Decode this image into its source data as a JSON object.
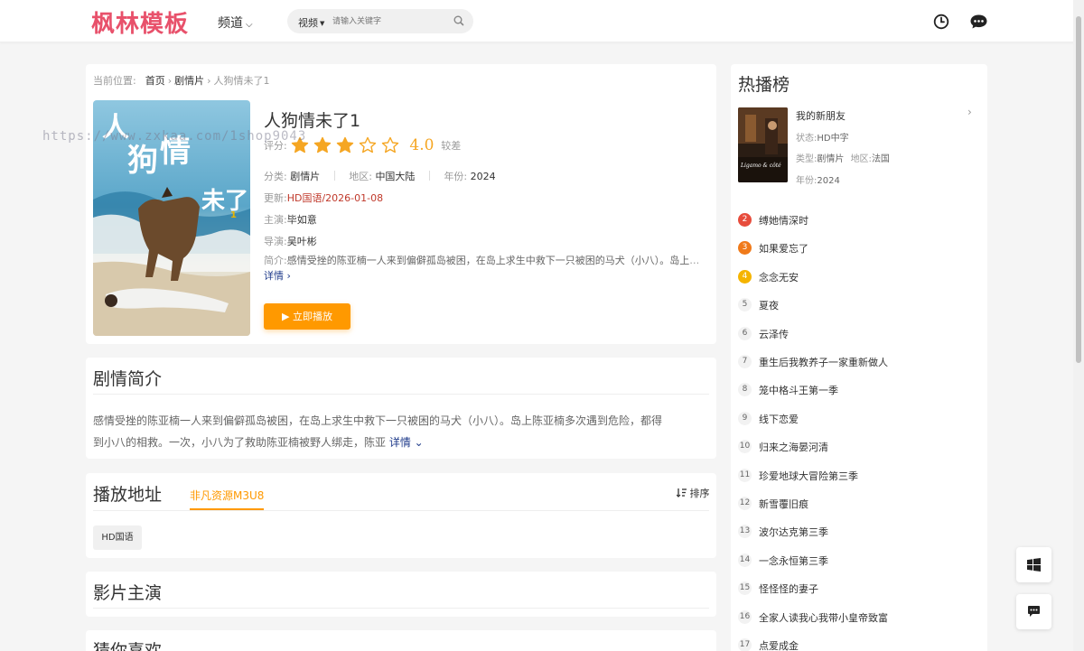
{
  "header": {
    "logo": "枫林模板",
    "channel_label": "频道",
    "search_type": "视频",
    "search_placeholder": "请输入关键字",
    "icons": [
      "history-icon",
      "chat-icon",
      "search-icon"
    ]
  },
  "breadcrumb": {
    "label": "当前位置:",
    "home": "首页",
    "category": "剧情片",
    "current": "人狗情未了1"
  },
  "movie": {
    "title": "人狗情未了1",
    "rating_label": "评分:",
    "rating_value": 3,
    "rating_max": 5,
    "score": "4.0",
    "grade": "较差",
    "genre_label": "分类:",
    "genre": "剧情片",
    "region_label": "地区:",
    "region": "中国大陆",
    "year_label": "年份:",
    "year": "2024",
    "update_label": "更新:",
    "update": "HD国语/2026-01-08",
    "actor_label": "主演:",
    "actor": "毕如意",
    "director_label": "导演:",
    "director": "吴叶彬",
    "brief_label": "简介:",
    "brief": "感情受挫的陈亚楠一人来到偏僻孤岛被困，在岛上求生中救下一只被困的马犬（小八）。岛上陈亚楠多次遇到危险，都得到小八的相救。",
    "more_label": "详情 ›",
    "play_label": "▶ 立即播放"
  },
  "watermark": "https://www.zxkaa.com/1shop9043",
  "synopsis": {
    "title": "剧情简介",
    "line1": "感情受挫的陈亚楠一人来到偏僻孤岛被困，在岛上求生中救下一只被困的马犬（小八）。岛上陈亚楠多次遇到危险，都得",
    "line2": "到小八的相救。一次，小八为了救助陈亚楠被野人绑走，陈亚",
    "more_label": "详情 ⌄"
  },
  "play_source": {
    "title": "播放地址",
    "tab": "非凡资源M3U8",
    "sort_label": "排序",
    "episodes": [
      "HD国语"
    ]
  },
  "cast_section": {
    "title": "影片主演"
  },
  "guess_section": {
    "title": "猜你喜欢"
  },
  "sidebar": {
    "title": "热播榜",
    "featured": {
      "name": "我的新朋友",
      "status_label": "状态:",
      "status": "HD中字",
      "type_label": "类型:",
      "type": "剧情片",
      "region_label": "地区:",
      "region": "法国",
      "year_label": "年份:",
      "year": "2024",
      "poster_text": "Ligamo & côté"
    },
    "ranking": [
      {
        "rank": "2",
        "name": "缚她情深时"
      },
      {
        "rank": "3",
        "name": "如果爱忘了"
      },
      {
        "rank": "4",
        "name": "念念无安"
      },
      {
        "rank": "5",
        "name": "夏夜"
      },
      {
        "rank": "6",
        "name": "云泽传"
      },
      {
        "rank": "7",
        "name": "重生后我教养子一家重新做人"
      },
      {
        "rank": "8",
        "name": "笼中格斗王第一季"
      },
      {
        "rank": "9",
        "name": "线下恋爱"
      },
      {
        "rank": "10",
        "name": "归来之海晏河清"
      },
      {
        "rank": "11",
        "name": "珍爱地球大冒险第三季"
      },
      {
        "rank": "12",
        "name": "新雪覆旧痕"
      },
      {
        "rank": "13",
        "name": "波尔达克第三季"
      },
      {
        "rank": "14",
        "name": "一念永恒第三季"
      },
      {
        "rank": "15",
        "name": "怪怪怪的妻子"
      },
      {
        "rank": "16",
        "name": "全家人读我心我带小皇帝致富"
      },
      {
        "rank": "17",
        "name": "点爱成金"
      }
    ]
  },
  "colors": {
    "logo": "#e8516b",
    "accent": "#ff9900",
    "star": "#f5a623",
    "update": "#c0392b",
    "link": "#1e3a8a"
  }
}
